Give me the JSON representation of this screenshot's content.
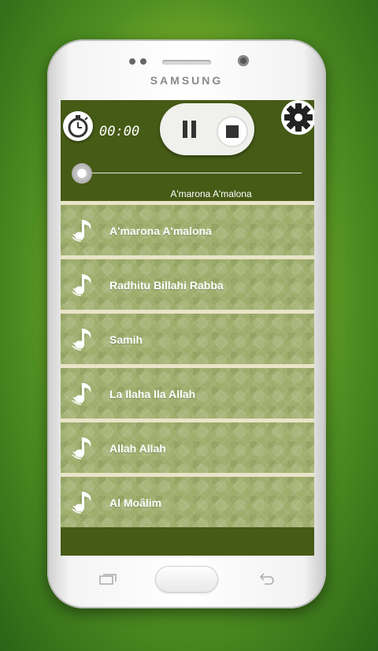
{
  "device": {
    "brand": "SAMSUNG"
  },
  "player": {
    "elapsed_time": "00:00",
    "now_playing": "A'marona A'malona",
    "seek_progress": 0,
    "icons": {
      "timer": "stopwatch-icon",
      "pause": "pause-icon",
      "stop": "stop-icon",
      "settings": "gear-icon",
      "seek": "seek-knob"
    }
  },
  "tracks": [
    {
      "label": "A'marona A'malona",
      "icon": "music-note-icon"
    },
    {
      "label": "Radhitu Billahi Rabba",
      "icon": "music-note-icon"
    },
    {
      "label": "Samih",
      "icon": "music-note-icon"
    },
    {
      "label": "La Ilaha Ila Allah",
      "icon": "music-note-icon"
    },
    {
      "label": "Allah Allah",
      "icon": "music-note-icon"
    },
    {
      "label": "Al Moâlim",
      "icon": "music-note-icon"
    }
  ],
  "colors": {
    "header": "#465b16",
    "list_row": "#9fae6d",
    "separator": "#e9e4c8"
  }
}
